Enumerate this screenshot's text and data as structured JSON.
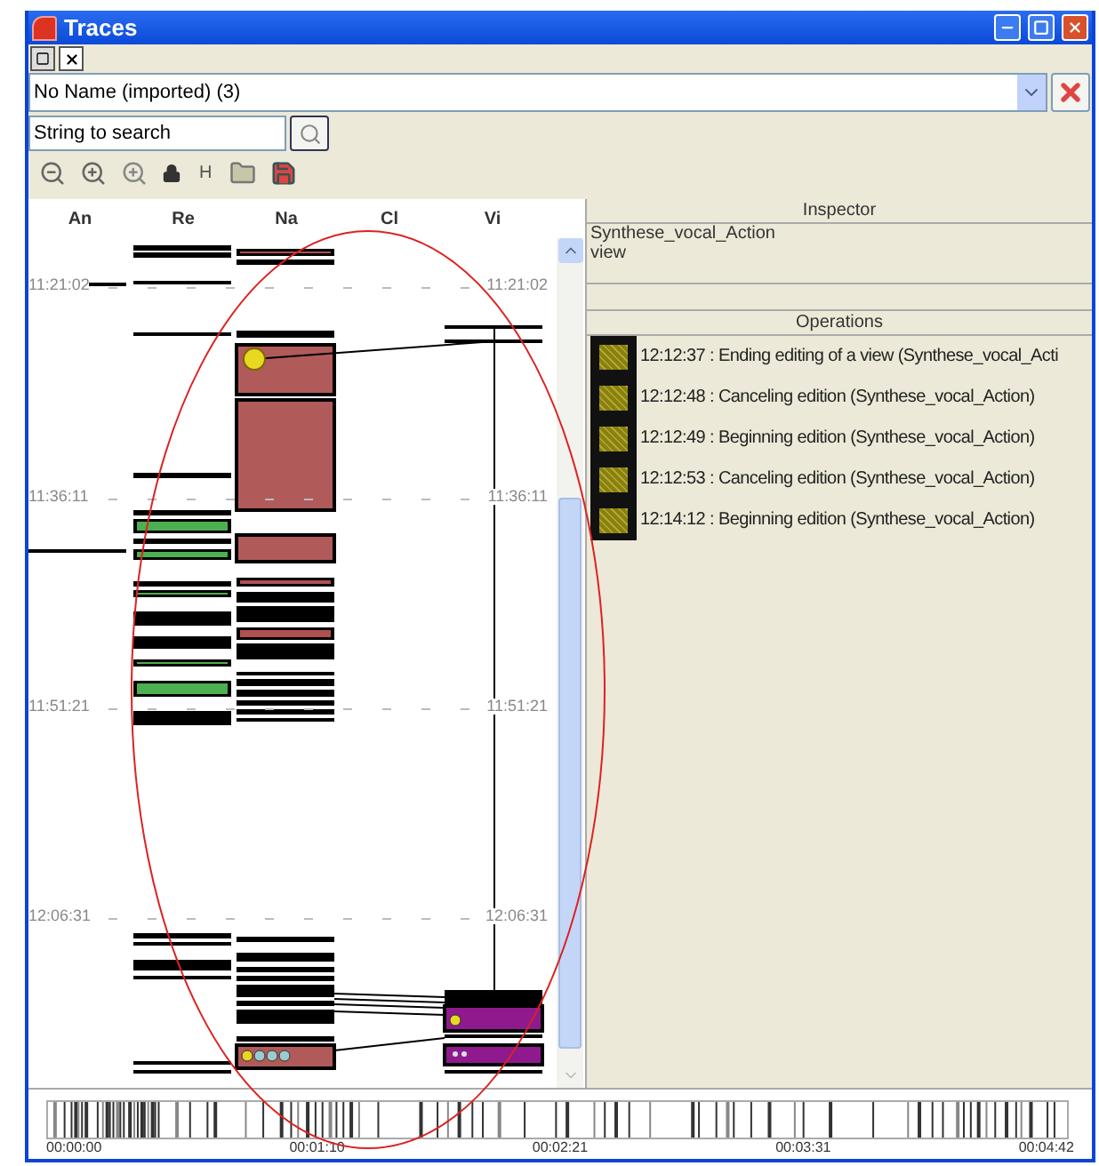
{
  "window": {
    "title": "Traces"
  },
  "trace_selector": {
    "value": "No Name (imported) (3)"
  },
  "search": {
    "placeholder": "String to search"
  },
  "toolbar": {
    "text_button": "H"
  },
  "trace_view": {
    "columns": [
      "An",
      "Re",
      "Na",
      "Cl",
      "Vi"
    ],
    "time_marks_left": [
      "11:21:02",
      "11:36:11",
      "11:51:21",
      "12:06:31"
    ],
    "time_marks_right": [
      "11:21:02",
      "11:36:11",
      "11:51:21",
      "12:06:31"
    ]
  },
  "inspector": {
    "title": "Inspector",
    "lines": [
      "Synthese_vocal_Action",
      "view"
    ]
  },
  "operations": {
    "title": "Operations",
    "items": [
      "12:12:37 : Ending editing of a view (Synthese_vocal_Acti",
      "12:12:48 : Canceling edition (Synthese_vocal_Action)",
      "12:12:49 : Beginning edition (Synthese_vocal_Action)",
      "12:12:53 : Canceling edition (Synthese_vocal_Action)",
      "12:14:12 : Beginning edition (Synthese_vocal_Action)"
    ]
  },
  "timeline": {
    "ticks": [
      "00:00:00",
      "00:01:10",
      "00:02:21",
      "00:03:31",
      "00:04:42"
    ]
  }
}
